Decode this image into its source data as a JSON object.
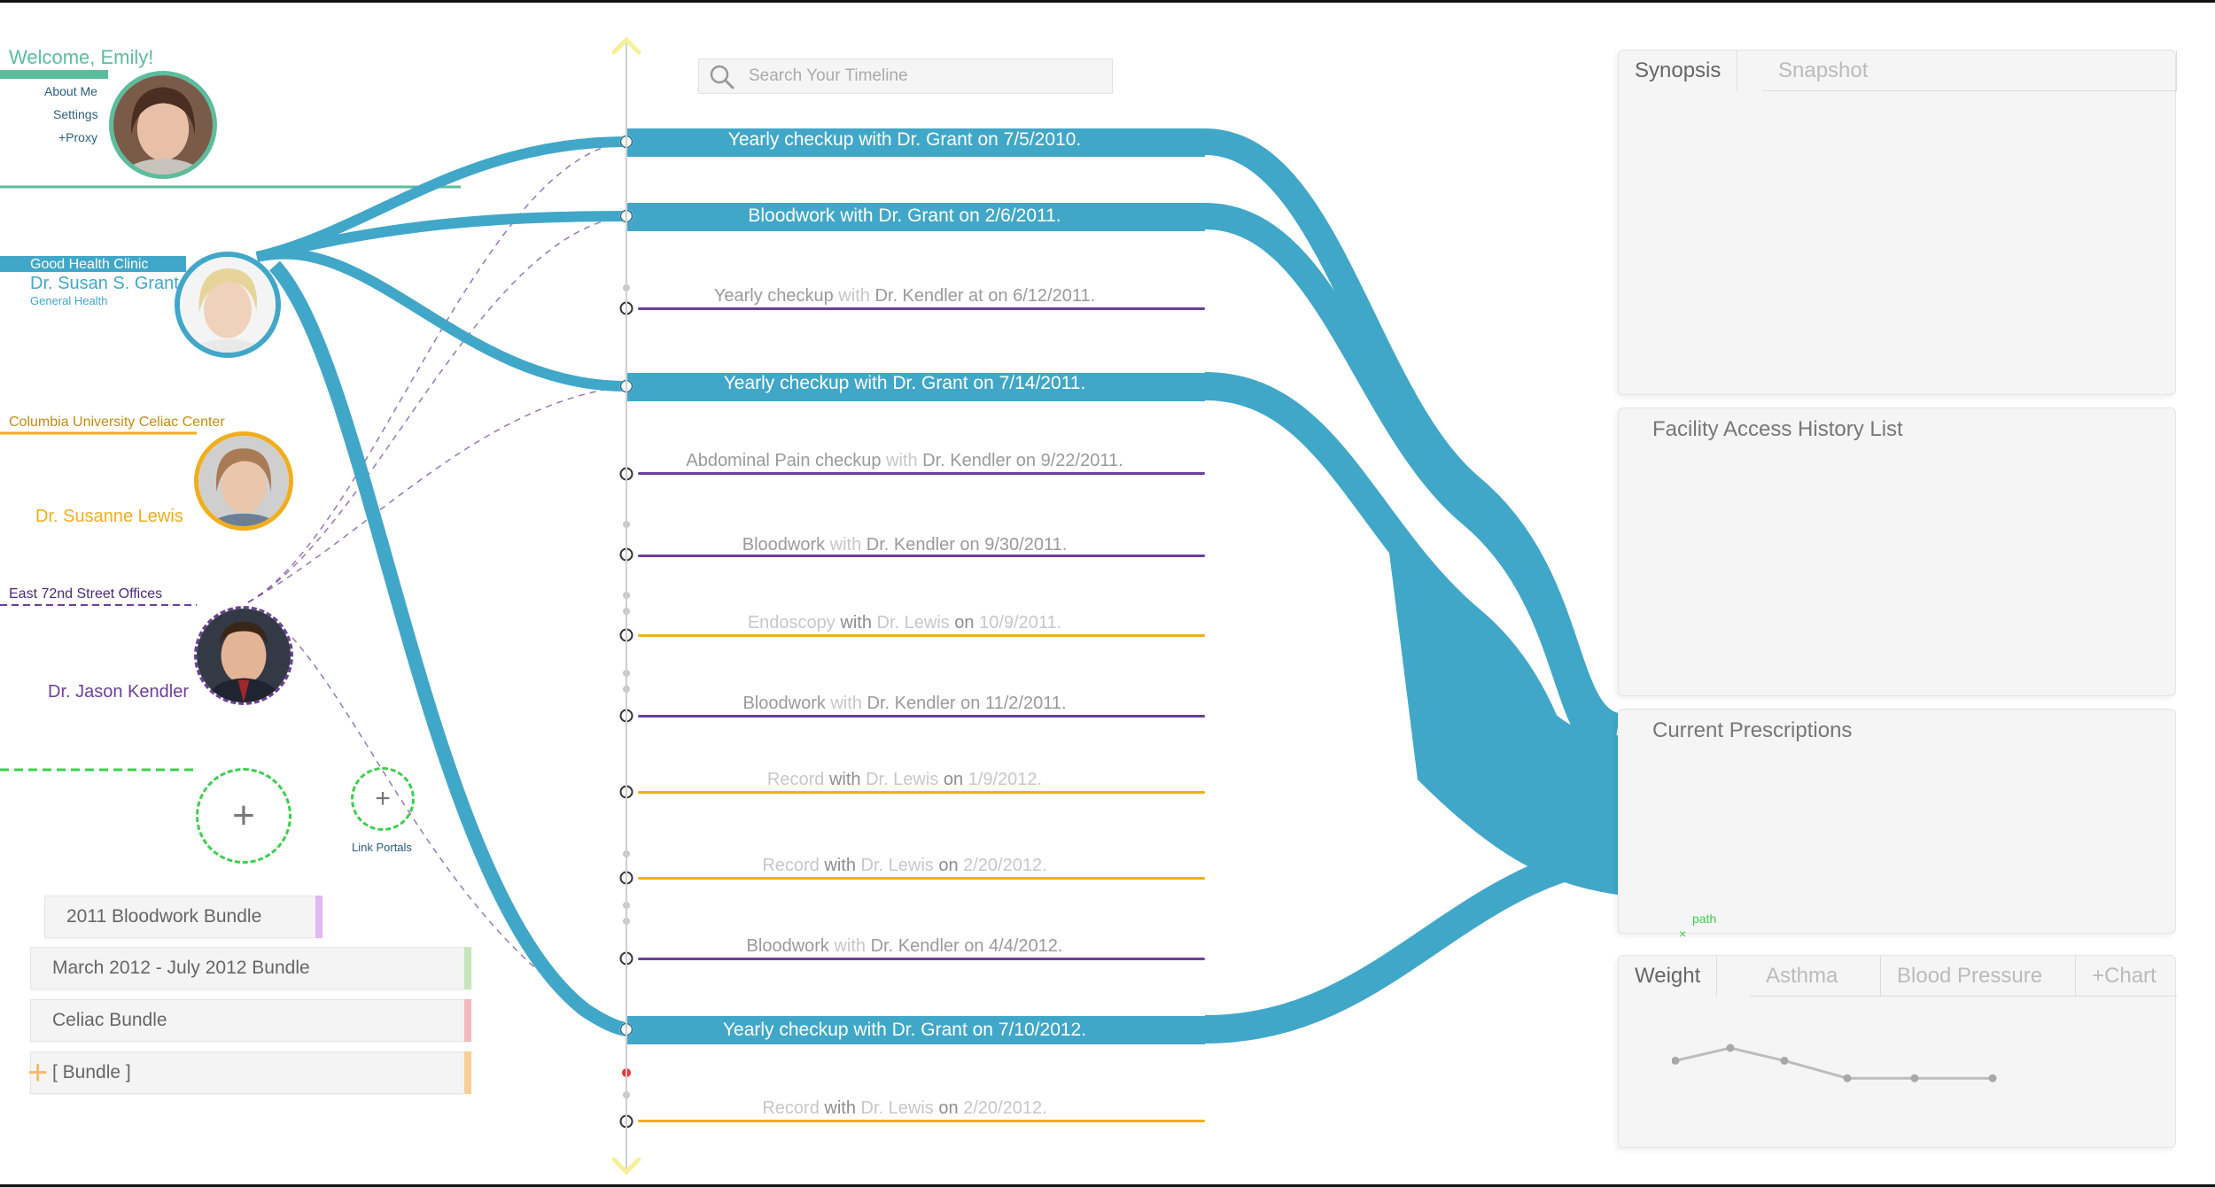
{
  "user": {
    "welcome": "Welcome, Emily!",
    "menu": [
      "About Me",
      "Settings",
      "+Proxy"
    ]
  },
  "providers": [
    {
      "clinic": "Good Health Clinic",
      "doctor": "Dr. Susan S. Grant",
      "specialty": "General Health",
      "color": "#41a7c8"
    },
    {
      "clinic": "Columbia University Celiac Center",
      "doctor": "Dr. Susanne Lewis",
      "specialty": "",
      "color": "#f1ae1c"
    },
    {
      "clinic": "East 72nd Street Offices",
      "doctor": "Dr. Jason Kendler",
      "specialty": "",
      "color": "#6b3f99"
    }
  ],
  "link_portals": "Link Portals",
  "bundles": [
    {
      "label": "2011 Bloodwork Bundle",
      "color": "#e2b8f0"
    },
    {
      "label": "March 2012 - July 2012 Bundle",
      "color": "#c4e6b8"
    },
    {
      "label": "Celiac Bundle",
      "color": "#f5b9bd"
    },
    {
      "label": "[ Bundle ]",
      "color": "#f7cf96"
    }
  ],
  "search": {
    "placeholder": "Search Your Timeline"
  },
  "timeline": [
    {
      "kind": "major",
      "text": "Yearly checkup with Dr. Grant on 7/5/2010."
    },
    {
      "kind": "major",
      "text": "Bloodwork with Dr. Grant on 2/6/2011."
    },
    {
      "kind": "minor",
      "p1": "Yearly checkup",
      "p2": " with ",
      "p3": "Dr. Kendler",
      "p4": " at on 6/12/2011.",
      "color": "#6b3f99"
    },
    {
      "kind": "major",
      "text": "Yearly checkup with Dr. Grant on 7/14/2011."
    },
    {
      "kind": "minor",
      "p1": "Abdominal Pain checkup",
      "p2": " with ",
      "p3": "Dr. Kendler",
      "p4": " on 9/22/2011.",
      "color": "#6b3f99"
    },
    {
      "kind": "minor",
      "p1": "Bloodwork",
      "p2": " with ",
      "p3": "Dr. Kendler",
      "p4": " on 9/30/2011.",
      "color": "#6b3f99"
    },
    {
      "kind": "faint",
      "p1": "Endoscopy",
      "p2": " with ",
      "p3": "Dr. Lewis",
      "p4": " on ",
      "p5": "10/9/2011.",
      "color": "#f1ae1c"
    },
    {
      "kind": "minor",
      "p1": "Bloodwork",
      "p2": " with ",
      "p3": "Dr. Kendler",
      "p4": " on 11/2/2011.",
      "color": "#6b3f99"
    },
    {
      "kind": "faint",
      "p1": "Record",
      "p2": " with ",
      "p3": "Dr. Lewis",
      "p4": " on ",
      "p5": "1/9/2012.",
      "color": "#f1ae1c"
    },
    {
      "kind": "faint",
      "p1": "Record",
      "p2": " with ",
      "p3": "Dr. Lewis",
      "p4": " on ",
      "p5": "2/20/2012.",
      "color": "#f1ae1c"
    },
    {
      "kind": "minor",
      "p1": "Bloodwork",
      "p2": " with ",
      "p3": "Dr. Kendler",
      "p4": " on 4/4/2012.",
      "color": "#6b3f99"
    },
    {
      "kind": "major",
      "text": "Yearly checkup with Dr. Grant on 7/10/2012."
    },
    {
      "kind": "faint",
      "p1": "Record",
      "p2": " with ",
      "p3": "Dr. Lewis",
      "p4": " on ",
      "p5": "2/20/2012.",
      "color": "#f1ae1c"
    }
  ],
  "panels": {
    "tabs_top": [
      "Synopsis",
      "Snapshot"
    ],
    "facility": "Facility Access History List",
    "prescriptions": "Current Prescriptions",
    "path_label": "path",
    "chart_tabs": [
      "Weight",
      "Asthma",
      "Blood Pressure",
      "+Chart"
    ]
  },
  "weight_trend": [
    0.4,
    0.0,
    0.4,
    0.95,
    0.95,
    0.95
  ],
  "colors": {
    "flow": "#41a7c8",
    "grant": "#41a7c8",
    "lewis": "#f1ae1c",
    "kendler": "#6b3f99",
    "add": "#3ccf4e",
    "welcome": "#5bbd9c"
  }
}
